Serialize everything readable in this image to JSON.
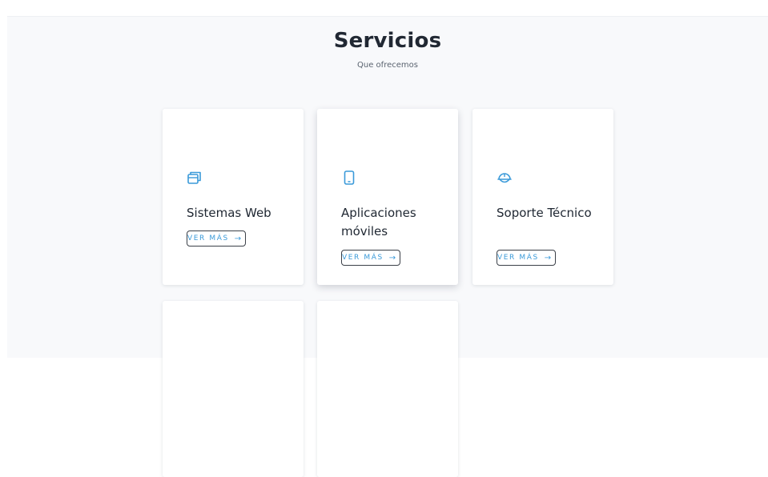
{
  "section": {
    "title": "Servicios",
    "subtitle": "Que ofrecemos"
  },
  "accent_color": "#3a9ad9",
  "cards": [
    {
      "title": "Sistemas Web",
      "icon": "window-stack-icon",
      "button_label": "VER MÁS",
      "button_icon": "arrow-right-icon"
    },
    {
      "title": "Aplicaciones móviles",
      "icon": "mobile-phone-icon",
      "button_label": "VER MÁS",
      "button_icon": "arrow-right-icon"
    },
    {
      "title": "Soporte Técnico",
      "icon": "hard-hat-icon",
      "button_label": "VER MÁS",
      "button_icon": "arrow-right-icon"
    }
  ]
}
